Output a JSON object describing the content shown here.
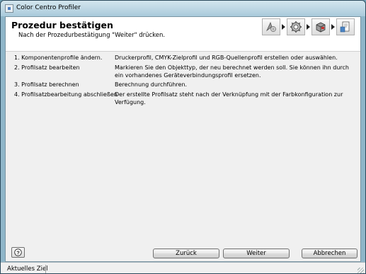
{
  "window": {
    "title": "Color Centro Profiler"
  },
  "header": {
    "title": "Prozedur bestätigen",
    "subtitle": "Nach der Prozedurbestätigung \"Weiter\" drücken."
  },
  "steps": [
    {
      "name": "1. Komponentenprofile ändern.",
      "desc": "Druckerprofil, CMYK-Zielprofil und RGB-Quellenprofil erstellen oder auswählen."
    },
    {
      "name": "2. Profilsatz bearbeiten",
      "desc": "Markieren Sie den Objekttyp, der neu berechnet werden soll. Sie können ihn durch ein vorhandenes Geräteverbindungsprofil ersetzen."
    },
    {
      "name": "3. Profilsatz berechnen",
      "desc": "Berechnung durchführen."
    },
    {
      "name": "4. Profilsatzbearbeitung abschließen",
      "desc": "Der erstellte Profilsatz steht nach der Verknüpfung mit der Farbkonfiguration zur Verfügung."
    }
  ],
  "buttons": {
    "help": "?",
    "back": "Zurück",
    "next": "Weiter",
    "cancel": "Abbrechen"
  },
  "status": {
    "label": "Aktuelles Ziel"
  }
}
